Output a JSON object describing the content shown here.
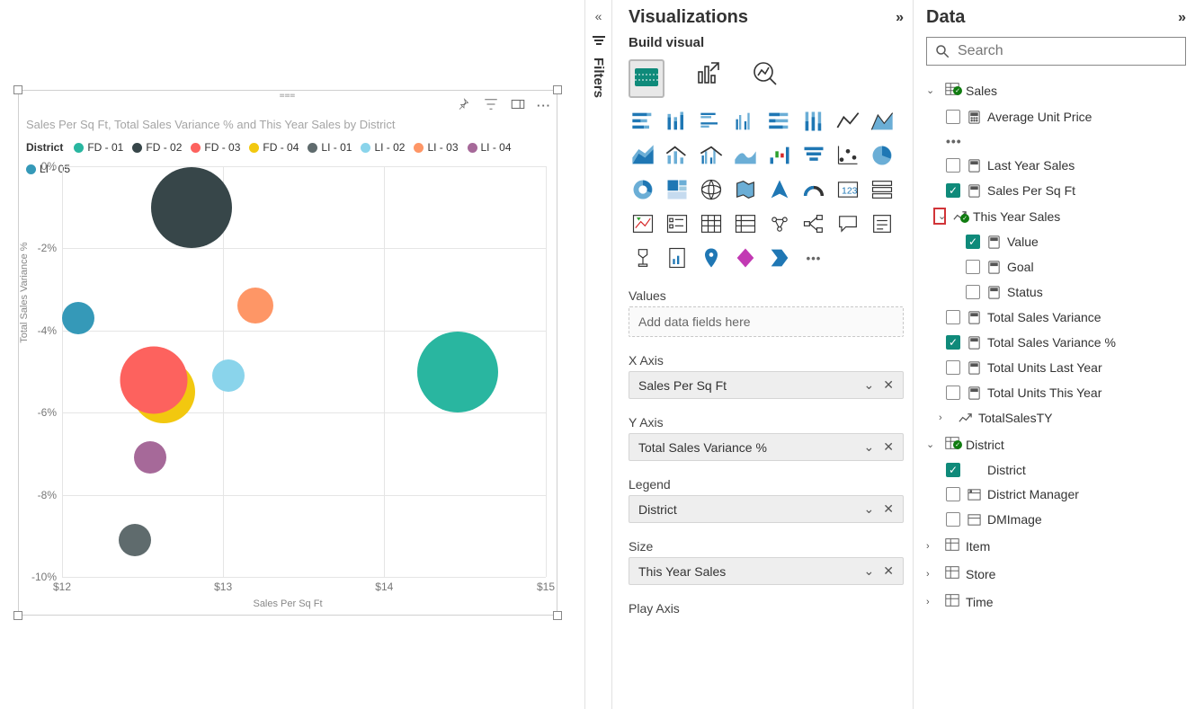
{
  "panes": {
    "filters_label": "Filters",
    "visualizations_title": "Visualizations",
    "build_visual_label": "Build visual",
    "data_title": "Data",
    "search_placeholder": "Search"
  },
  "visual": {
    "title": "Sales Per Sq Ft, Total Sales Variance % and This Year Sales by District",
    "legend_title": "District",
    "legend_items": [
      {
        "label": "FD - 01",
        "color": "#29b6a0"
      },
      {
        "label": "FD - 02",
        "color": "#374649"
      },
      {
        "label": "FD - 03",
        "color": "#fd625e"
      },
      {
        "label": "FD - 04",
        "color": "#f2c80f"
      },
      {
        "label": "LI - 01",
        "color": "#5f6b6d"
      },
      {
        "label": "LI - 02",
        "color": "#8ad4eb"
      },
      {
        "label": "LI - 03",
        "color": "#fe9666"
      },
      {
        "label": "LI - 04",
        "color": "#a66999"
      },
      {
        "label": "LI - 05",
        "color": "#3599b8"
      }
    ],
    "xlabel": "Sales Per Sq Ft",
    "ylabel": "Total Sales Variance %",
    "x_ticks": [
      "$12",
      "$13",
      "$14",
      "$15"
    ],
    "y_ticks": [
      "0%",
      "-2%",
      "-4%",
      "-6%",
      "-8%",
      "-10%"
    ]
  },
  "chart_data": {
    "type": "scatter",
    "title": "Sales Per Sq Ft, Total Sales Variance % and This Year Sales by District",
    "xlabel": "Sales Per Sq Ft",
    "ylabel": "Total Sales Variance %",
    "xlim": [
      12,
      15
    ],
    "ylim": [
      -10,
      0
    ],
    "size_field": "This Year Sales",
    "series": [
      {
        "name": "FD - 01",
        "color": "#29b6a0",
        "x": 14.45,
        "y": -5.0,
        "size": 90
      },
      {
        "name": "FD - 02",
        "color": "#374649",
        "x": 12.8,
        "y": -1.0,
        "size": 90
      },
      {
        "name": "FD - 03",
        "color": "#fd625e",
        "x": 12.57,
        "y": -5.2,
        "size": 75
      },
      {
        "name": "FD - 04",
        "color": "#f2c80f",
        "x": 12.63,
        "y": -5.5,
        "size": 70
      },
      {
        "name": "LI - 01",
        "color": "#5f6b6d",
        "x": 12.45,
        "y": -9.1,
        "size": 35
      },
      {
        "name": "LI - 02",
        "color": "#8ad4eb",
        "x": 13.03,
        "y": -5.1,
        "size": 35
      },
      {
        "name": "LI - 03",
        "color": "#fe9666",
        "x": 13.2,
        "y": -3.4,
        "size": 40
      },
      {
        "name": "LI - 04",
        "color": "#a66999",
        "x": 12.55,
        "y": -7.1,
        "size": 35
      },
      {
        "name": "LI - 05",
        "color": "#3599b8",
        "x": 12.1,
        "y": -3.7,
        "size": 35
      }
    ]
  },
  "wells": {
    "values_label": "Values",
    "values_placeholder": "Add data fields here",
    "xaxis_label": "X Axis",
    "xaxis_value": "Sales Per Sq Ft",
    "yaxis_label": "Y Axis",
    "yaxis_value": "Total Sales Variance %",
    "legend_label": "Legend",
    "legend_value": "District",
    "size_label": "Size",
    "size_value": "This Year Sales",
    "playaxis_label": "Play Axis"
  },
  "data_tree": {
    "sales": {
      "label": "Sales",
      "fields": {
        "avg_unit_price": "Average Unit Price",
        "last_year_sales": "Last Year Sales",
        "sales_per_sqft": "Sales Per Sq Ft",
        "this_year_sales": "This Year Sales",
        "value": "Value",
        "goal": "Goal",
        "status": "Status",
        "total_sales_variance": "Total Sales Variance",
        "total_sales_variance_pct": "Total Sales Variance %",
        "total_units_last_year": "Total Units Last Year",
        "total_units_this_year": "Total Units This Year",
        "total_sales_ty": "TotalSalesTY"
      }
    },
    "district": {
      "label": "District",
      "fields": {
        "district": "District",
        "district_manager": "District Manager",
        "dm_image": "DMImage"
      }
    },
    "item": {
      "label": "Item"
    },
    "store": {
      "label": "Store"
    },
    "time": {
      "label": "Time"
    }
  }
}
